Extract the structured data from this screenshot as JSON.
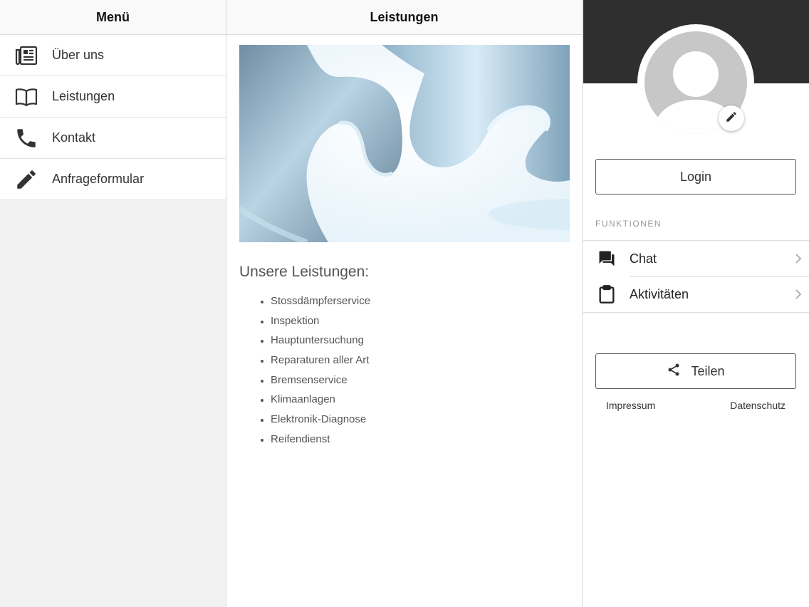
{
  "menu": {
    "title": "Menü",
    "items": [
      {
        "label": "Über uns",
        "icon": "newspaper-icon"
      },
      {
        "label": "Leistungen",
        "icon": "open-book-icon"
      },
      {
        "label": "Kontakt",
        "icon": "phone-icon"
      },
      {
        "label": "Anfrageformular",
        "icon": "pencil-icon"
      }
    ]
  },
  "content": {
    "title": "Leistungen",
    "hero_image": "wrench-photo",
    "heading": "Unsere Leistungen:",
    "services": [
      "Stossdämpferservice",
      "Inspektion",
      "Hauptuntersuchung",
      "Reparaturen aller Art",
      "Bremsenservice",
      "Klimaanlagen",
      "Elektronik-Diagnose",
      "Reifendienst"
    ]
  },
  "profile": {
    "login_label": "Login",
    "section_label": "FUNKTIONEN",
    "functions": [
      {
        "label": "Chat",
        "icon": "chat-icon"
      },
      {
        "label": "Aktivitäten",
        "icon": "clipboard-icon"
      }
    ],
    "share_label": "Teilen",
    "footer": {
      "impressum": "Impressum",
      "datenschutz": "Datenschutz"
    }
  },
  "colors": {
    "profile_header": "#2f2f2f",
    "avatar_placeholder": "#c7c7c7",
    "menu_background": "#f2f2f2"
  }
}
